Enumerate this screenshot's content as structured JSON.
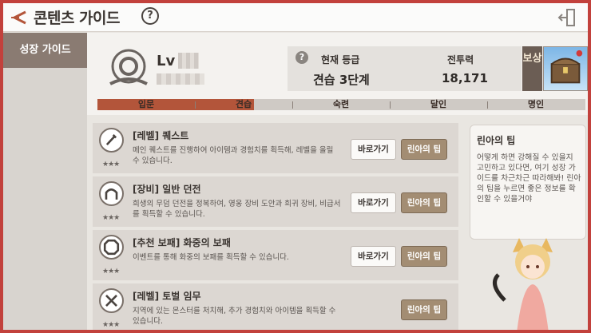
{
  "header": {
    "title": "콘텐츠 가이드",
    "help": "?"
  },
  "sidebar": {
    "items": [
      {
        "label": "성장 가이드"
      }
    ]
  },
  "profile": {
    "level_prefix": "Lv"
  },
  "stats": {
    "help": "?",
    "grade_label": "현재 등급",
    "grade_value": "견습 3단계",
    "power_label": "전투력",
    "power_value": "18,171"
  },
  "reward": {
    "label": "보상"
  },
  "progress": {
    "current_fraction": 0.32,
    "stages": [
      "입문",
      "견습",
      "숙련",
      "달인",
      "명인"
    ]
  },
  "guides": [
    {
      "title": "[레벨] 퀘스트",
      "desc": "메인 퀘스트를 진행하여 아이템과 경험치를 획득해, 레벨을 올릴 수 있습니다.",
      "stars": "★★★",
      "go": "바로가기",
      "tip": "린아의 팁",
      "icon": "sword-icon"
    },
    {
      "title": "[장비] 일반 던전",
      "desc": "희생의 무덤 던전을 정복하여, 영웅 장비 도안과 희귀 장비, 비급서를 획득할 수 있습니다.",
      "stars": "★★★",
      "go": "바로가기",
      "tip": "린아의 팁",
      "icon": "gate-icon"
    },
    {
      "title": "[추천 보패] 화중의 보패",
      "desc": "이벤트를 통해 화중의 보패를 획득할 수 있습니다.",
      "stars": "★★★",
      "go": "바로가기",
      "tip": "린아의 팁",
      "icon": "octagon-icon"
    },
    {
      "title": "[레벨] 토벌 임무",
      "desc": "지역에 있는 몬스터를 처치해, 추가 경험치와 아이템을 획득할 수 있습니다.",
      "stars": "★★★",
      "tip": "린아의 팁",
      "icon": "crossed-swords-icon"
    }
  ],
  "tip_panel": {
    "title": "린아의 팁",
    "body": "어떻게 하면 강해질 수 있을지 고민하고 있다면, 여기 성장 가이드를 차근차근 따라해봐! 린아의 팁을 누르면 좋은 정보를 확인할 수 있을거야"
  }
}
